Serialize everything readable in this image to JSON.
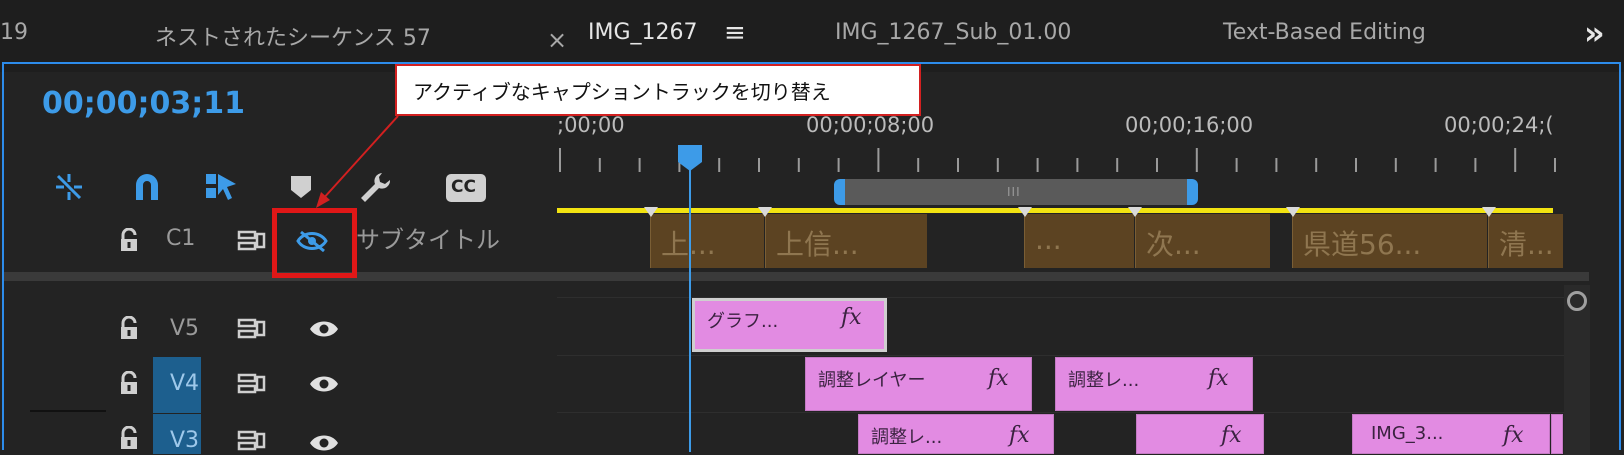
{
  "tabs": [
    {
      "label": "19"
    },
    {
      "label": "ネストされたシーケンス 57"
    },
    {
      "label": "IMG_1267"
    },
    {
      "label": "IMG_1267_Sub_01.00"
    },
    {
      "label": "Text-Based Editing"
    }
  ],
  "tab_close_glyph": "×",
  "tab_menu_glyph": "≡",
  "overflow_glyph": "»",
  "timecode": "00;00;03;11",
  "ruler_labels": [
    ";00;00",
    "00;00;08;00",
    "00;00;16;00",
    "00;00;24;("
  ],
  "tools": [
    "ripple-insert-icon",
    "snap-magnet-icon",
    "linked-selection-icon",
    "add-marker-icon",
    "wrench-icon",
    "closed-captions-icon"
  ],
  "tools_cc_label": "CC",
  "range_grip": "III",
  "annotation": {
    "text": "アクティブなキャプショントラックを切り替え"
  },
  "caption_track": {
    "name": "C1",
    "label": "サブタイトル",
    "captions": [
      "上...",
      "上信...",
      "...",
      "次...",
      "県道56...",
      "清..."
    ]
  },
  "tracks": [
    {
      "name": "V5"
    },
    {
      "name": "V4"
    },
    {
      "name": "V3"
    }
  ],
  "clips": {
    "v5": [
      {
        "name": "グラフ...",
        "fx": "fx"
      }
    ],
    "v4": [
      {
        "name": "調整レイヤー",
        "fx": "fx"
      },
      {
        "name": "調整レ...",
        "fx": "fx"
      }
    ],
    "v3": [
      {
        "name": "調整レ...",
        "fx": "fx"
      },
      {
        "name": "",
        "fx": "fx"
      },
      {
        "name": "IMG_3...",
        "fx": "fx"
      }
    ]
  },
  "colors": {
    "accent": "#2d8ceb",
    "caption_bg": "#5c4322",
    "clip_pink": "#e28be2",
    "yellow": "#f2e311",
    "annotation_red": "#e01717"
  }
}
